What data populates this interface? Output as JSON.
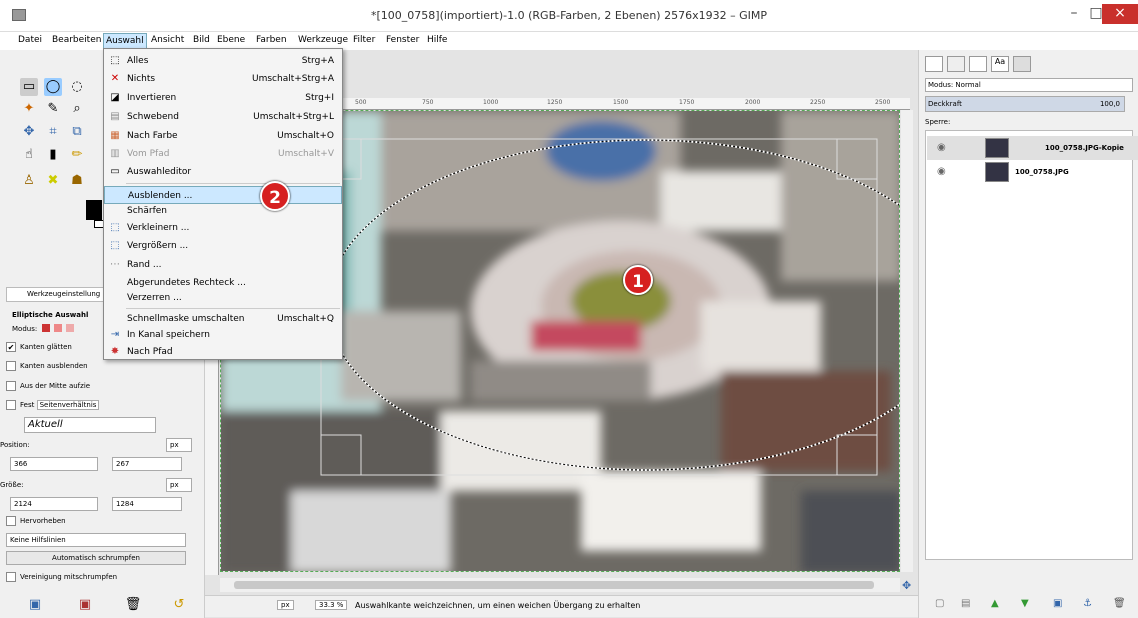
{
  "window": {
    "title": "*[100_0758](importiert)-1.0 (RGB-Farben, 2 Ebenen) 2576x1932 – GIMP",
    "controls": [
      "–",
      "□",
      "×"
    ]
  },
  "menubar": {
    "items": [
      "Datei",
      "Bearbeiten",
      "Auswahl",
      "Ansicht",
      "Bild",
      "Ebene",
      "Farben",
      "Werkzeuge",
      "Filter",
      "Fenster",
      "Hilfe"
    ],
    "active": "Auswahl"
  },
  "select_menu": {
    "items": [
      {
        "label": "Alles",
        "shortcut": "Strg+A",
        "icon": "select-all-icon",
        "glyph": "⬚"
      },
      {
        "label": "Nichts",
        "shortcut": "Umschalt+Strg+A",
        "icon": "select-none-icon",
        "glyph": "✕"
      },
      {
        "label": "Invertieren",
        "shortcut": "Strg+I",
        "icon": "invert-icon",
        "glyph": "◪"
      },
      {
        "label": "Schwebend",
        "shortcut": "Umschalt+Strg+L",
        "icon": "float-icon",
        "glyph": "▤"
      },
      {
        "label": "Nach Farbe",
        "shortcut": "Umschalt+O",
        "icon": "by-color-icon",
        "glyph": "▦"
      },
      {
        "label": "Vom Pfad",
        "shortcut": "Umschalt+V",
        "icon": "from-path-icon",
        "glyph": "▥",
        "disabled": true
      },
      {
        "label": "Auswahleditor",
        "shortcut": "",
        "icon": "selection-editor-icon",
        "glyph": "▭"
      },
      {
        "label": "Ausblenden ...",
        "shortcut": "",
        "icon": "",
        "glyph": "",
        "highlighted": true
      },
      {
        "label": "Schärfen",
        "shortcut": "",
        "icon": "",
        "glyph": ""
      },
      {
        "label": "Verkleinern ...",
        "shortcut": "",
        "icon": "shrink-icon",
        "glyph": "⬚"
      },
      {
        "label": "Vergrößern ...",
        "shortcut": "",
        "icon": "grow-icon",
        "glyph": "⬚"
      },
      {
        "label": "Rand ...",
        "shortcut": "",
        "icon": "border-icon",
        "glyph": "⋯"
      },
      {
        "label": "Abgerundetes Rechteck ...",
        "shortcut": "",
        "icon": "",
        "glyph": ""
      },
      {
        "label": "Verzerren ...",
        "shortcut": "",
        "icon": "",
        "glyph": ""
      },
      {
        "label": "Schnellmaske umschalten",
        "shortcut": "Umschalt+Q",
        "icon": "",
        "glyph": ""
      },
      {
        "label": "In Kanal speichern",
        "shortcut": "",
        "icon": "save-channel-icon",
        "glyph": "⇥"
      },
      {
        "label": "Nach Pfad",
        "shortcut": "",
        "icon": "to-path-icon",
        "glyph": "✸"
      }
    ]
  },
  "markers": {
    "one": "1",
    "two": "2"
  },
  "tool_options": {
    "tab_label": "Werkzeugeinstellung",
    "tool_name": "Elliptische Auswahl",
    "mode_label": "Modus:",
    "antialias": "Kanten glätten",
    "feather": "Kanten ausblenden",
    "expand_center": "Aus der Mitte aufzie",
    "fixed": "Fest",
    "fixed_value": "Seitenverhältnis",
    "aspect_value": "Aktuell",
    "position_label": "Position:",
    "pos_x": "366",
    "pos_y": "267",
    "unit_pos": "px",
    "size_label": "Größe:",
    "size_w": "2124",
    "size_h": "1284",
    "unit_size": "px",
    "highlight": "Hervorheben",
    "guides": "Keine Hilfslinien",
    "autoshrink": "Automatisch schrumpfen",
    "merged": "Vereinigung mitschrumpfen"
  },
  "ruler": {
    "ticks": [
      "500",
      "750",
      "1000",
      "1250",
      "1500",
      "1750",
      "2000",
      "2250",
      "2500"
    ]
  },
  "statusbar": {
    "unit": "px",
    "zoom": "33.3 %",
    "message": "Auswahlkante weichzeichnen, um einen weichen Übergang zu erhalten"
  },
  "layers_panel": {
    "mode_label": "Modus: Normal",
    "opacity_label": "Deckkraft",
    "opacity_value": "100,0",
    "lock_label": "Sperre:",
    "layers": [
      {
        "name": "100_0758.JPG-Kopie"
      },
      {
        "name": "100_0758.JPG"
      }
    ]
  },
  "colors": {
    "accent": "#cce8ff",
    "marker": "#d62020",
    "close": "#c9302c"
  }
}
